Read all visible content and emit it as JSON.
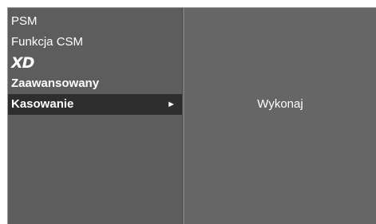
{
  "menu": {
    "items": [
      {
        "label": "PSM"
      },
      {
        "label": "Funkcja CSM"
      },
      {
        "label": "XD"
      },
      {
        "label": "Zaawansowany"
      },
      {
        "label": "Kasowanie",
        "selected": true,
        "arrow": "►"
      }
    ]
  },
  "submenu": {
    "action_label": "Wykonaj"
  },
  "colors": {
    "panel_bg": "#5d5d5d",
    "right_bg": "#666666",
    "highlight_bg": "#2e2e2e",
    "text": "#ffffff"
  }
}
